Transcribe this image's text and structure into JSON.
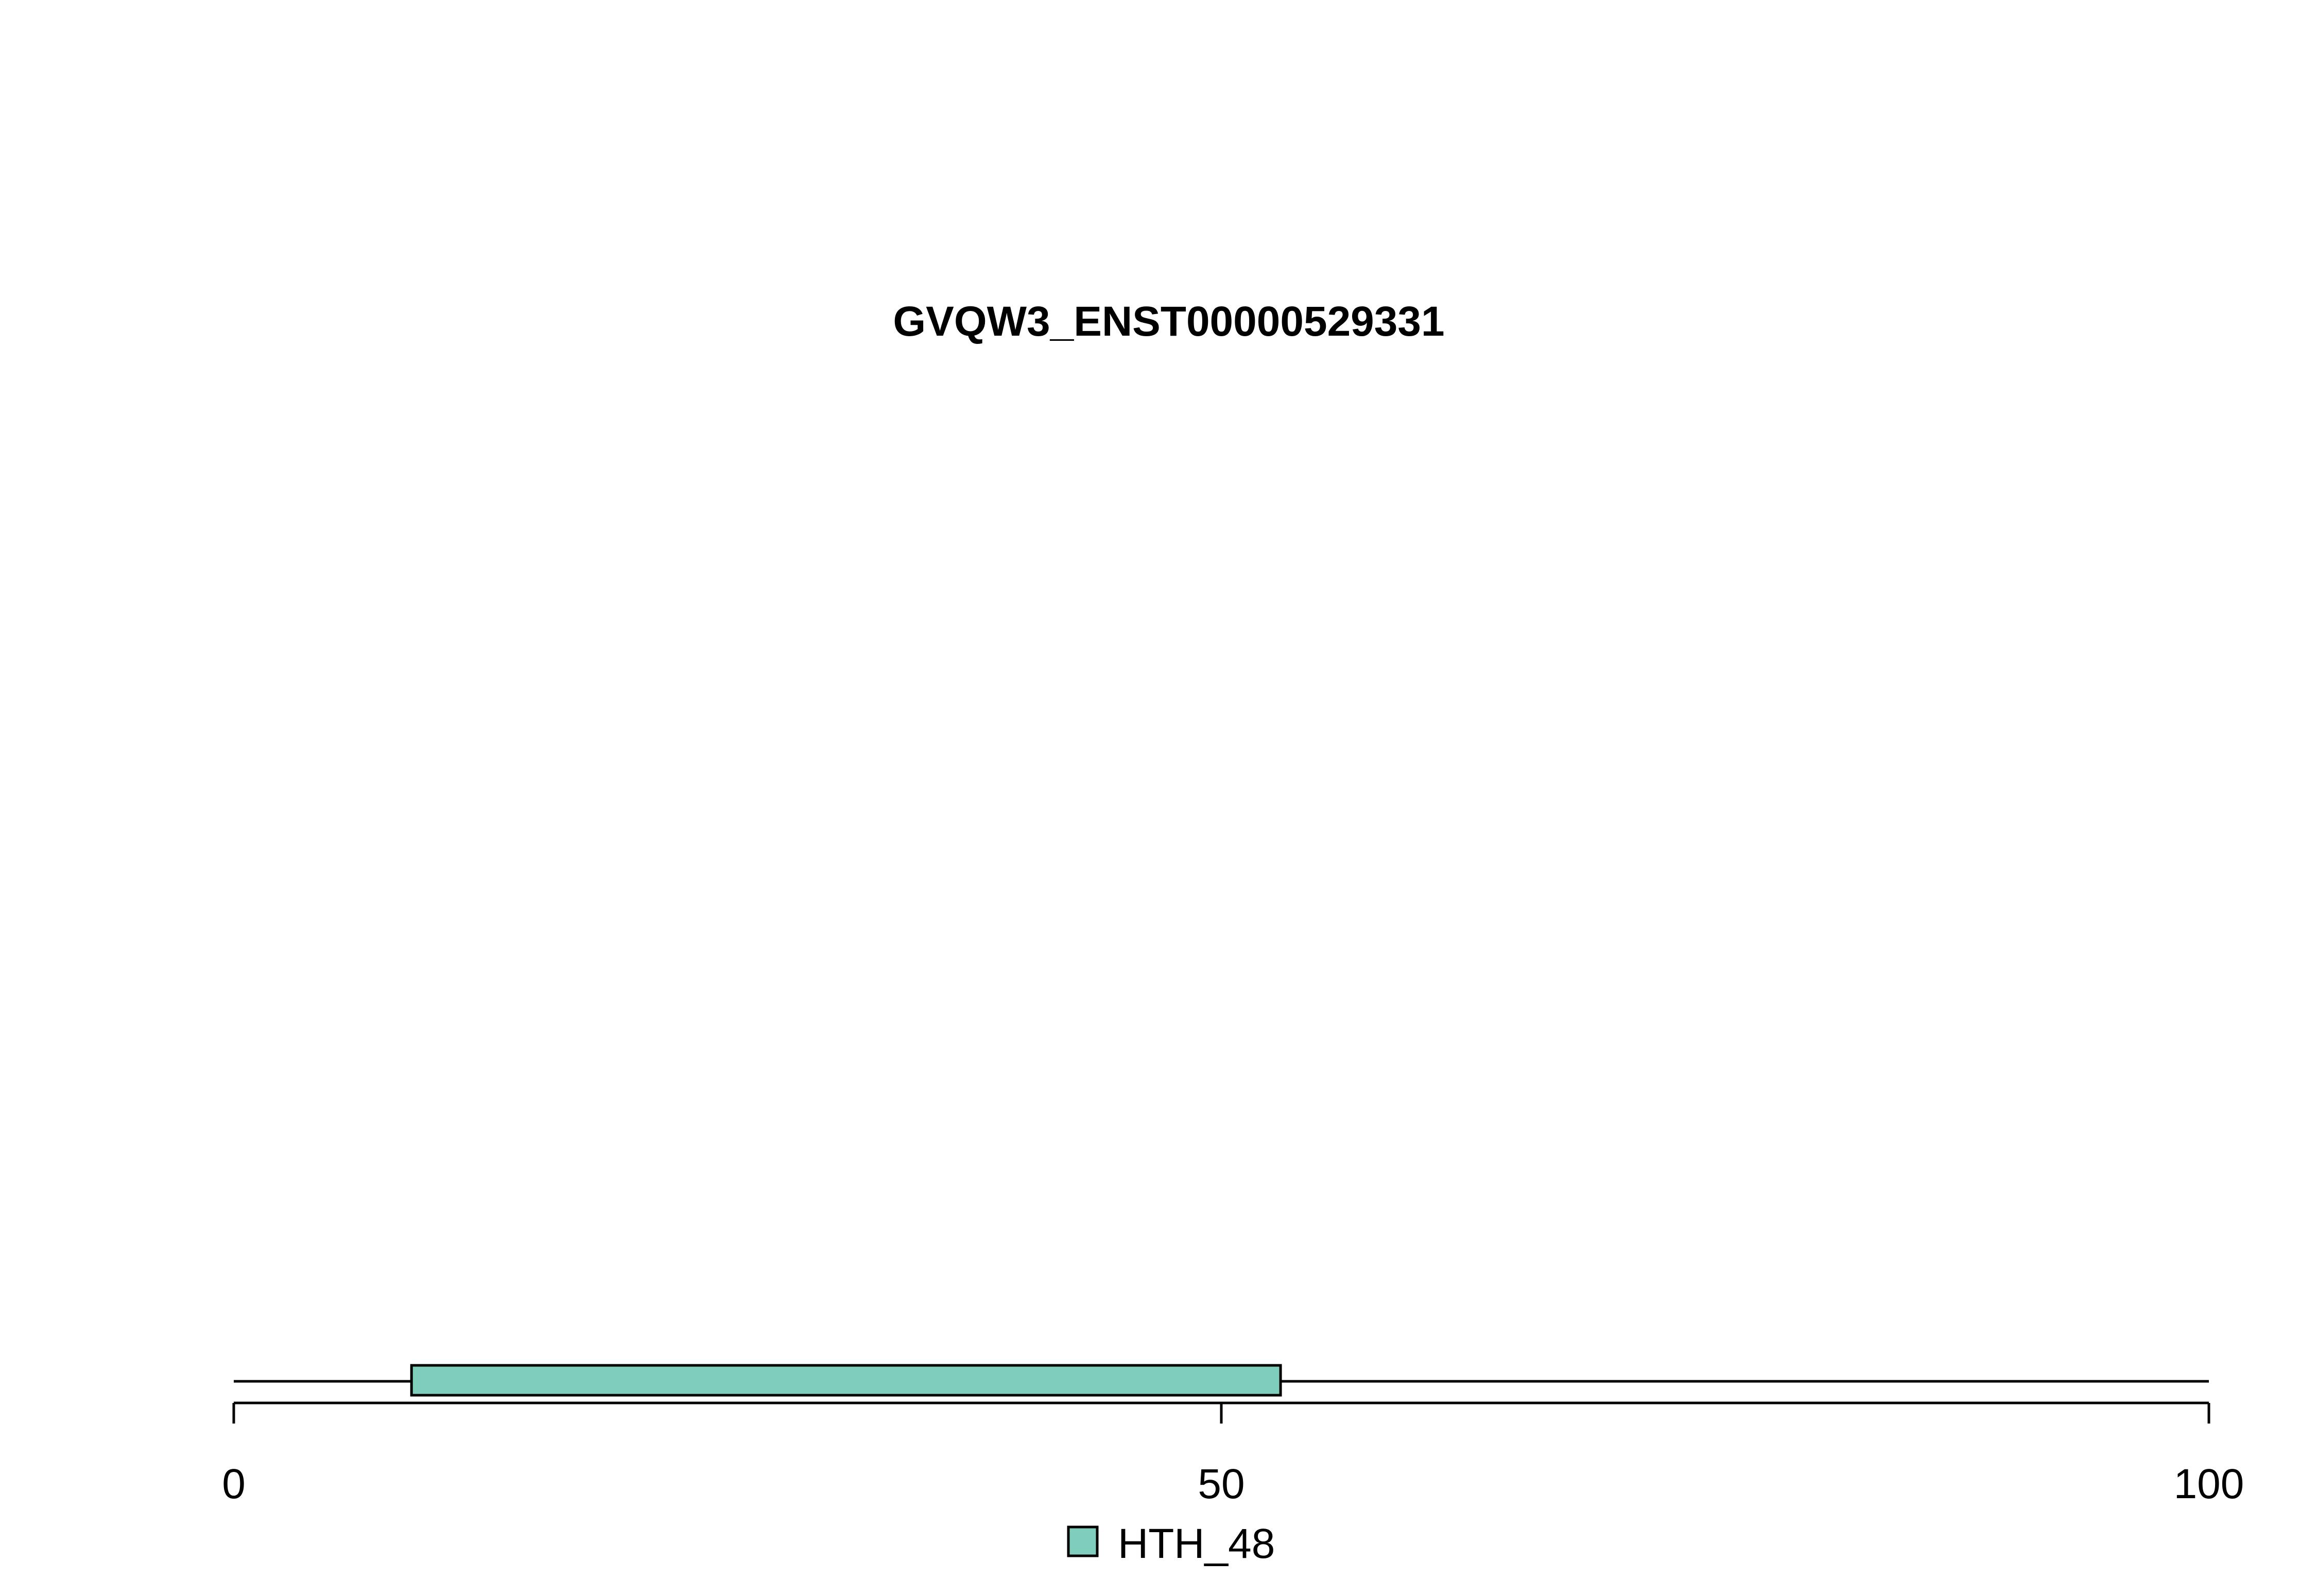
{
  "title": "GVQW3_ENST00000529331",
  "protein": {
    "length": 100
  },
  "axis": {
    "min": 0,
    "max": 100,
    "ticks": [
      {
        "value": 0,
        "label": "0"
      },
      {
        "value": 50,
        "label": "50"
      },
      {
        "value": 100,
        "label": "100"
      }
    ]
  },
  "domains": [
    {
      "name": "HTH_48",
      "start": 9,
      "end": 53,
      "color": "#7fcdbb"
    }
  ],
  "legend": [
    {
      "label": "HTH_48",
      "color": "#7fcdbb"
    }
  ],
  "colors": {
    "line": "#000000",
    "background": "#ffffff"
  }
}
